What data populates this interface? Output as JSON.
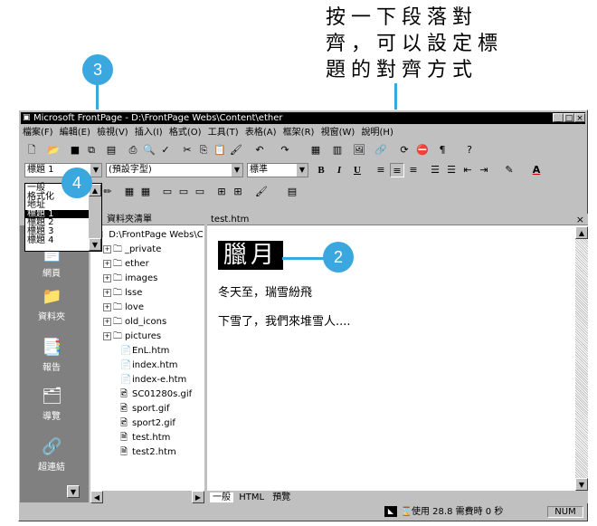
{
  "annotation": {
    "caption_lines": [
      "按一下段落對",
      "齊，可以設定標",
      "題的對齊方式"
    ],
    "callouts": [
      "3",
      "4",
      "2"
    ]
  },
  "window": {
    "title": "Microsoft FrontPage - D:\\FrontPage Webs\\Content\\ether",
    "controls": [
      "_",
      "□",
      "×"
    ]
  },
  "menu": [
    "檔案(F)",
    "編輯(E)",
    "檢視(V)",
    "插入(I)",
    "格式(O)",
    "工具(T)",
    "表格(A)",
    "框架(R)",
    "視窗(W)",
    "說明(H)"
  ],
  "format_bar": {
    "style_value": "標題 1",
    "font_value": "(預設字型)",
    "size_value": "標準",
    "bold": "B",
    "italic": "I",
    "underline": "U"
  },
  "style_dropdown": {
    "options": [
      "一般",
      "格式化",
      "地址",
      "標題 1",
      "標題 2",
      "標題 3",
      "標題 4"
    ],
    "selected_index": 3
  },
  "views": [
    {
      "label": "網頁",
      "icon": "page-icon"
    },
    {
      "label": "資料夾",
      "icon": "folder-icon"
    },
    {
      "label": "報告",
      "icon": "report-icon"
    },
    {
      "label": "導覽",
      "icon": "navigation-icon"
    },
    {
      "label": "超連結",
      "icon": "hyperlink-icon"
    }
  ],
  "folder_list": {
    "header": "資料夾清單",
    "root": "D:\\FrontPage Webs\\C",
    "folders": [
      "_private",
      "ether",
      "images",
      "lsse",
      "love",
      "old_icons",
      "pictures"
    ],
    "files": [
      "EnL.htm",
      "index.htm",
      "index-e.htm",
      "SC01280s.gif",
      "sport.gif",
      "sport2.gif",
      "test.htm",
      "test2.htm"
    ]
  },
  "editor": {
    "tab_title": "test.htm",
    "close": "×",
    "heading": "臘月",
    "para1": "冬天至，瑞雪紛飛",
    "para2": "下雪了，我們來堆雪人....",
    "view_tabs": [
      "一般",
      "HTML",
      "預覽"
    ]
  },
  "status": {
    "text": "使用 28.8 需費時 0 秒",
    "num": "NUM"
  }
}
